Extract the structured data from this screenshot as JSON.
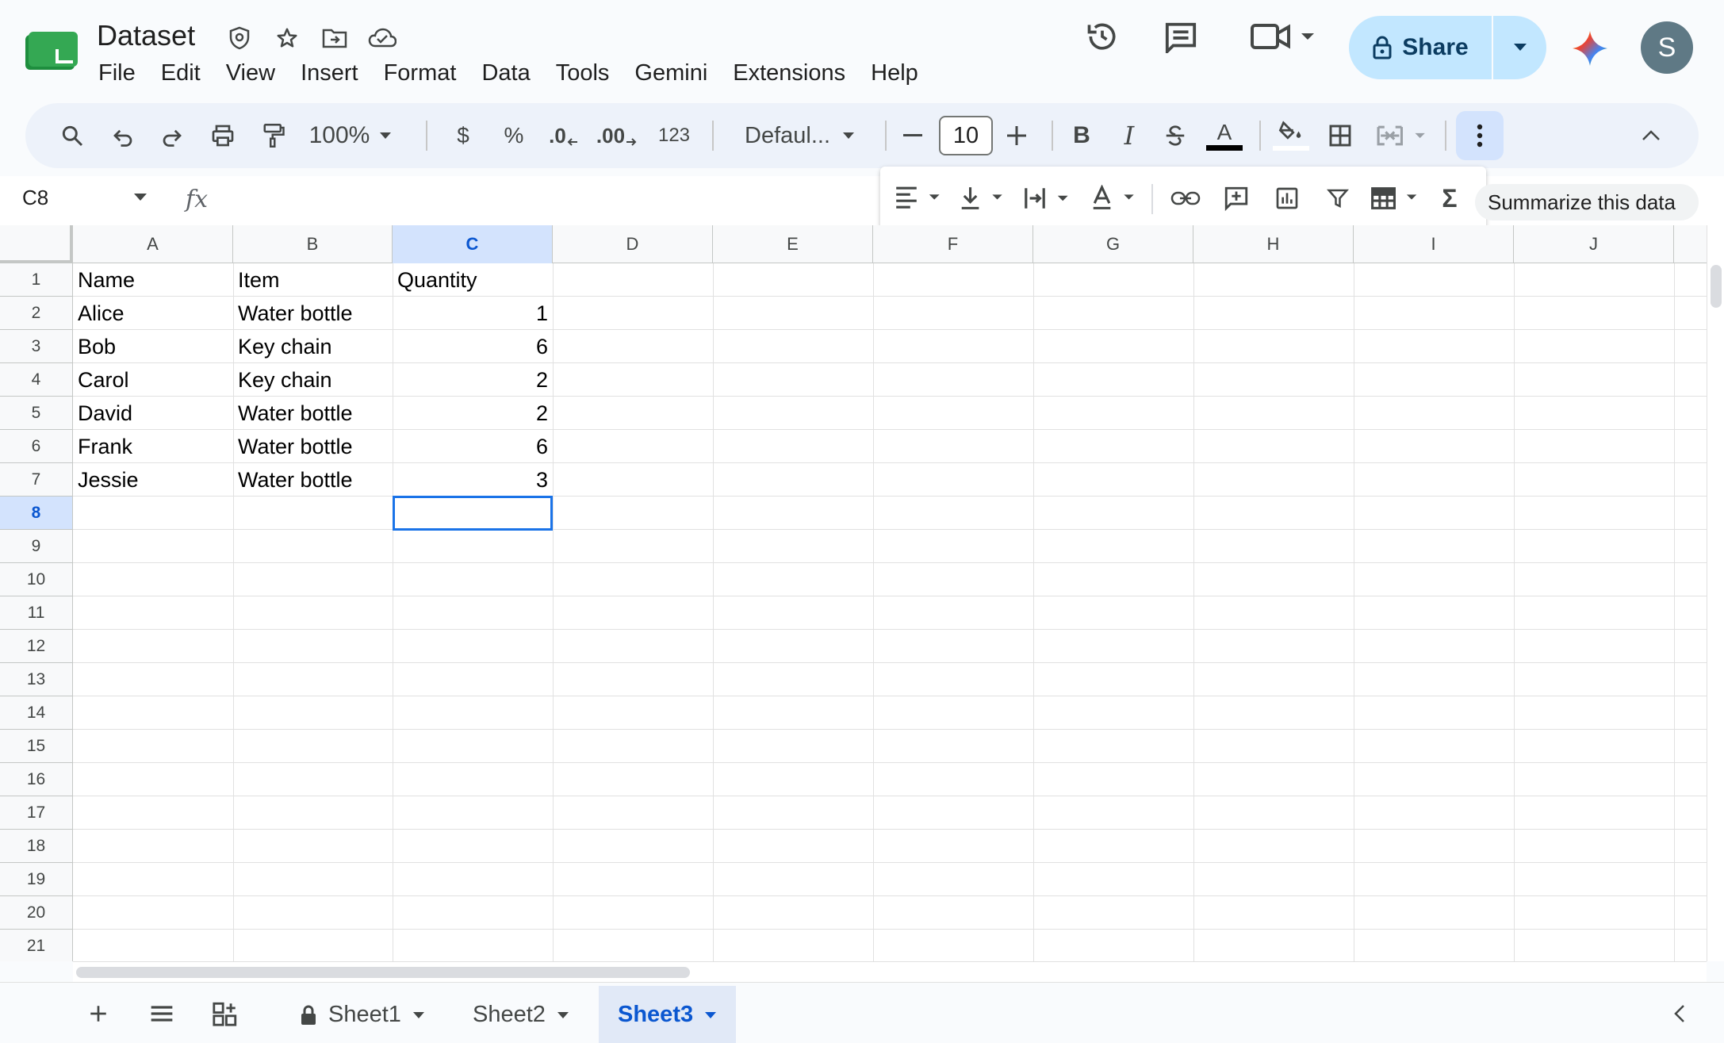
{
  "app": {
    "title": "Dataset",
    "menu": [
      "File",
      "Edit",
      "View",
      "Insert",
      "Format",
      "Data",
      "Tools",
      "Gemini",
      "Extensions",
      "Help"
    ],
    "share_label": "Share",
    "avatar_initial": "S"
  },
  "toolbar": {
    "zoom": "100%",
    "currency_symbol": "$",
    "percent_symbol": "%",
    "decrease_decimal": ".0",
    "increase_decimal": ".00",
    "number_format": "123",
    "font": "Defaul...",
    "font_size": "10",
    "bold": "B",
    "italic": "I",
    "text_color_letter": "A"
  },
  "formula_bar": {
    "cell_ref": "C8",
    "fx": "fx",
    "value": ""
  },
  "floating_bar": {
    "summarize_label": "Summarize this data",
    "sum_symbol": "Σ"
  },
  "grid": {
    "columns": [
      "A",
      "B",
      "C",
      "D",
      "E",
      "F",
      "G",
      "H",
      "I",
      "J"
    ],
    "active_column": "C",
    "rows": [
      "1",
      "2",
      "3",
      "4",
      "5",
      "6",
      "7",
      "8",
      "9",
      "10",
      "11",
      "12",
      "13",
      "14",
      "15",
      "16",
      "17",
      "18",
      "19",
      "20",
      "21"
    ],
    "active_row": "8",
    "cells": [
      [
        "Name",
        "Item",
        "Quantity"
      ],
      [
        "Alice",
        "Water bottle",
        "1"
      ],
      [
        "Bob",
        "Key chain",
        "6"
      ],
      [
        "Carol",
        "Key chain",
        "2"
      ],
      [
        "David",
        "Water bottle",
        "2"
      ],
      [
        "Frank",
        "Water bottle",
        "6"
      ],
      [
        "Jessie",
        "Water bottle",
        "3"
      ]
    ]
  },
  "sheets": {
    "tabs": [
      {
        "label": "Sheet1",
        "locked": true
      },
      {
        "label": "Sheet2",
        "locked": false
      },
      {
        "label": "Sheet3",
        "locked": false,
        "active": true
      }
    ]
  },
  "colors": {
    "accent": "#0b57d0",
    "share_bg": "#c2e7ff",
    "selection": "#1a73e8",
    "header_active": "#d3e3fd"
  }
}
